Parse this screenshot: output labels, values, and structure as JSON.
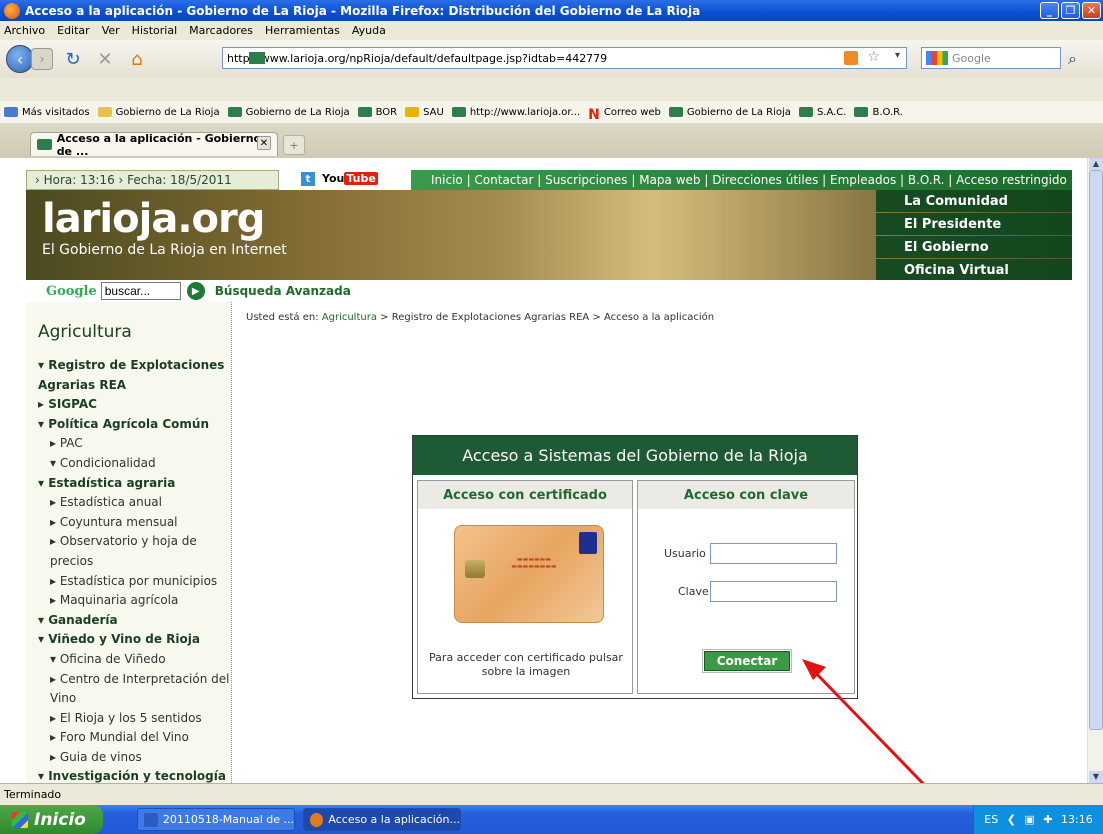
{
  "window": {
    "title": "Acceso a la aplicación - Gobierno de La Rioja - Mozilla Firefox: Distribución del Gobierno de La Rioja",
    "controls": [
      "minimize-icon",
      "maximize-icon",
      "close-icon"
    ]
  },
  "menu": [
    "Archivo",
    "Editar",
    "Ver",
    "Historial",
    "Marcadores",
    "Herramientas",
    "Ayuda"
  ],
  "navbar": {
    "url": "http://www.larioja.org/npRioja/default/defaultpage.jsp?idtab=442779",
    "search_placeholder": "Google"
  },
  "bookmarks": [
    {
      "label": "Más visitados",
      "icon": "blue"
    },
    {
      "label": "Gobierno de La Rioja",
      "icon": "folder"
    },
    {
      "label": "Gobierno de La Rioja",
      "icon": "site"
    },
    {
      "label": "BOR",
      "icon": "site"
    },
    {
      "label": "SAU",
      "icon": "site"
    },
    {
      "label": "http://www.larioja.or...",
      "icon": "site"
    },
    {
      "label": "Correo web",
      "icon": "n"
    },
    {
      "label": "Gobierno de La Rioja",
      "icon": "site"
    },
    {
      "label": "S.A.C.",
      "icon": "site"
    },
    {
      "label": "B.O.R.",
      "icon": "site"
    }
  ],
  "tab": {
    "label": "Acceso a la aplicación - Gobierno de ..."
  },
  "site": {
    "datetime": "› Hora: 13:16   › Fecha: 18/5/2011",
    "twitter": "t",
    "youtube_you": "You",
    "youtube_tube": "Tube",
    "topnav": "Inicio | Contactar | Suscripciones | Mapa web | Direcciones útiles | Empleados | B.O.R. | Acceso restringido |",
    "logo": "larioja.org",
    "tagline": "El Gobierno de La Rioja en Internet",
    "right_menu": [
      "La Comunidad",
      "El Presidente",
      "El Gobierno",
      "Oficina Virtual"
    ],
    "search_logo": "Google",
    "search_value": "buscar...",
    "advanced_search": "Búsqueda Avanzada"
  },
  "sidebar": {
    "title": "Agricultura",
    "items": [
      {
        "label": "▾ Registro de Explotaciones",
        "level": 1
      },
      {
        "label": "  Agrarias REA",
        "level": 1
      },
      {
        "label": "▸ SIGPAC",
        "level": 1
      },
      {
        "label": "▾ Política Agrícola Común",
        "level": 1
      },
      {
        "label": "▸ PAC",
        "level": 2
      },
      {
        "label": "▾ Condicionalidad",
        "level": 2
      },
      {
        "label": "▾ Estadística agraria",
        "level": 1
      },
      {
        "label": "▸ Estadística anual",
        "level": 2
      },
      {
        "label": "▸ Coyuntura mensual",
        "level": 2
      },
      {
        "label": "▸ Observatorio y hoja de",
        "level": 2
      },
      {
        "label": "  precios",
        "level": 2
      },
      {
        "label": "▸ Estadística por municipios",
        "level": 2
      },
      {
        "label": "▸ Maquinaria agrícola",
        "level": 2
      },
      {
        "label": "▾ Ganadería",
        "level": 1
      },
      {
        "label": "▾ Viñedo y Vino de Rioja",
        "level": 1
      },
      {
        "label": "▾ Oficina de Viñedo",
        "level": 2
      },
      {
        "label": "▸ Centro de Interpretación del",
        "level": 2
      },
      {
        "label": "  Vino",
        "level": 2
      },
      {
        "label": "▸ El Rioja y los 5 sentidos",
        "level": 2
      },
      {
        "label": "▸ Foro Mundial del Vino",
        "level": 2
      },
      {
        "label": "▸ Guia de vinos",
        "level": 2
      },
      {
        "label": "▾ Investigación y tecnología",
        "level": 1
      }
    ]
  },
  "breadcrumb": {
    "prefix": "Usted está en: ",
    "link": "Agricultura",
    "rest": " > Registro de Explotaciones Agrarias REA > Acceso a la aplicación"
  },
  "login": {
    "title": "Acceso a Sistemas del Gobierno de la Rioja",
    "cert_header": "Acceso con certificado",
    "cert_note": "Para acceder con certificado pulsar sobre la imagen",
    "key_header": "Acceso con clave",
    "user_label": "Usuario",
    "user_value": "",
    "pass_label": "Clave",
    "pass_value": "",
    "connect_label": "Conectar"
  },
  "statusbar": "Terminado",
  "taskbar": {
    "start": "Inicio",
    "tasks": [
      "20110518-Manual de ...",
      "Acceso a la aplicación..."
    ],
    "lang": "ES",
    "clock": "13:16"
  }
}
